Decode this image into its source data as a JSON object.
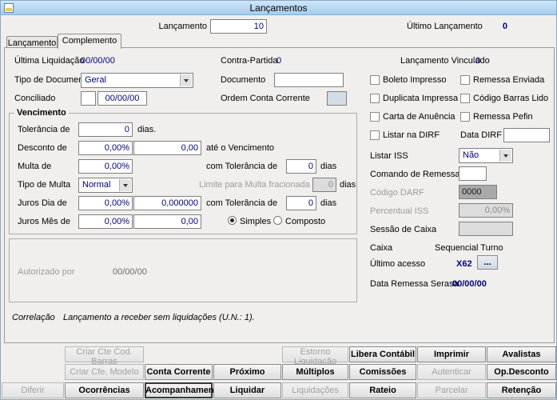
{
  "window": {
    "title": "Lançamentos"
  },
  "header": {
    "lancamento_label": "Lançamento",
    "lancamento_value": "10",
    "ultimo_lancamento_label": "Último Lançamento",
    "ultimo_lancamento_value": "0"
  },
  "tabs": [
    {
      "label": "Lançamento"
    },
    {
      "label": "Complemento"
    }
  ],
  "fields": {
    "ultima_liquidacao": {
      "label": "Última Liquidação",
      "value": "00/00/00"
    },
    "contra_partida": {
      "label": "Contra-Partida",
      "value": "0"
    },
    "lancamento_vinculado": {
      "label": "Lançamento Vinculado",
      "value": "0"
    },
    "tipo_documento": {
      "label": "Tipo de Documento",
      "value": "Geral"
    },
    "documento": {
      "label": "Documento",
      "value": ""
    },
    "conciliado": {
      "label": "Conciliado",
      "value": "",
      "date": "00/00/00"
    },
    "ordem_conta_corrente": {
      "label": "Ordem Conta Corrente",
      "value": ""
    }
  },
  "checkboxes": [
    {
      "label": "Boleto Impresso",
      "checked": false
    },
    {
      "label": "Remessa Enviada",
      "checked": false
    },
    {
      "label": "Duplicata Impressa",
      "checked": false
    },
    {
      "label": "Código Barras Lido",
      "checked": false
    },
    {
      "label": "Carta de Anuência",
      "checked": false
    },
    {
      "label": "Remessa Pefin",
      "checked": false
    },
    {
      "label": "Listar na DIRF",
      "checked": false
    }
  ],
  "right_panel": {
    "data_dirf": {
      "label": "Data DIRF",
      "value": ""
    },
    "listar_iss": {
      "label": "Listar ISS",
      "value": "Não"
    },
    "comando_remessa": {
      "label": "Comando de Remessa",
      "value": ""
    },
    "codigo_darf": {
      "label": "Código DARF",
      "value": "0000"
    },
    "percentual_iss": {
      "label": "Percentual ISS",
      "value": "0,00%"
    },
    "sessao_caixa": {
      "label": "Sessão de Caixa",
      "value": ""
    },
    "caixa": {
      "label": "Caixa",
      "value": "Sequencial Turno"
    },
    "ultimo_acesso": {
      "label": "Último acesso",
      "value": "X62",
      "browse": "..."
    },
    "data_remessa_serasa": {
      "label": "Data Remessa Serasa",
      "value": "00/00/00"
    }
  },
  "vencimento": {
    "title": "Vencimento",
    "tolerancia": {
      "label": "Tolerância de",
      "value": "0",
      "suffix": "dias."
    },
    "desconto": {
      "label": "Desconto de",
      "pct": "0,00%",
      "value": "0,00",
      "suffix": "até o Vencimento"
    },
    "multa": {
      "label": "Multa de",
      "pct": "0,00%",
      "tol_label": "com Tolerância de",
      "tol": "0",
      "suffix": "dias"
    },
    "tipo_multa": {
      "label": "Tipo de Multa",
      "value": "Normal",
      "limite_label": "Limite para Multa fracionada",
      "limite": "0",
      "suffix": "dias"
    },
    "juros_dia": {
      "label": "Juros Dia de",
      "pct": "0,00%",
      "value": "0,000000",
      "tol_label": "com Tolerância de",
      "tol": "0",
      "suffix": "dias"
    },
    "juros_mes": {
      "label": "Juros Mês de",
      "pct": "0,00%",
      "value": "0,00"
    },
    "radio_simples": "Simples",
    "radio_composto": "Composto"
  },
  "autorizado": {
    "label": "Autorizado por",
    "value": "00/00/00"
  },
  "correlacao": {
    "label": "Correlação",
    "text": "Lançamento a receber sem liquidações (U.N.: 1)."
  },
  "buttons": [
    {
      "label": "Criar Cte Cod. Barras",
      "enabled": false
    },
    {
      "label": "Estorno Liquidação",
      "enabled": false
    },
    {
      "label": "Libera Contábil",
      "enabled": true
    },
    {
      "label": "Imprimir",
      "enabled": true
    },
    {
      "label": "Avalistas",
      "enabled": true
    },
    {
      "label": "Criar Cfe. Modelo",
      "enabled": false
    },
    {
      "label": "Conta Corrente",
      "enabled": true
    },
    {
      "label": "Próximo",
      "enabled": true
    },
    {
      "label": "Múltiplos",
      "enabled": true
    },
    {
      "label": "Comissões",
      "enabled": true
    },
    {
      "label": "Autenticar",
      "enabled": false
    },
    {
      "label": "Op.Desconto",
      "enabled": true
    },
    {
      "label": "Diferir",
      "enabled": false
    },
    {
      "label": "Ocorrências",
      "enabled": true
    },
    {
      "label": "Acompanhamento",
      "enabled": true
    },
    {
      "label": "Liquidar",
      "enabled": true
    },
    {
      "label": "Liquidações",
      "enabled": false
    },
    {
      "label": "Rateio",
      "enabled": true
    },
    {
      "label": "Parcelar",
      "enabled": false
    },
    {
      "label": "Retenção",
      "enabled": true
    }
  ]
}
